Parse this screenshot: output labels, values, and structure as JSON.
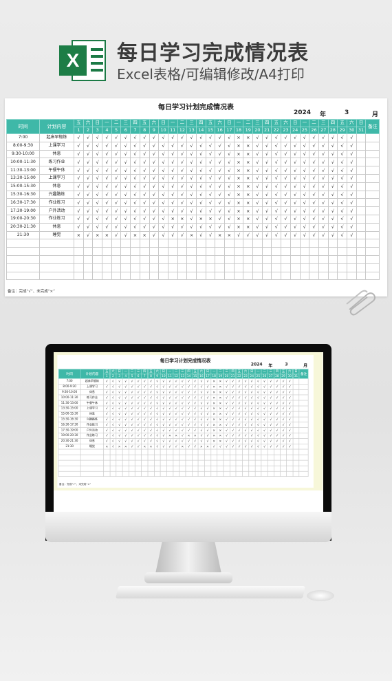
{
  "header": {
    "title": "每日学习完成情况表",
    "subtitle": "Excel表格/可编辑修改/A4打印",
    "logo_letter": "X"
  },
  "sheet": {
    "title": "每日学习计划完成情况表",
    "year": "2024",
    "year_unit": "年",
    "month": "3",
    "month_unit": "月",
    "col_time": "时间",
    "col_plan": "计划内容",
    "col_remark": "备注",
    "weekdays": [
      "五",
      "六",
      "日",
      "一",
      "二",
      "三",
      "四",
      "五",
      "六",
      "日",
      "一",
      "二",
      "三",
      "四",
      "五",
      "六",
      "日",
      "一",
      "二",
      "三",
      "四",
      "五",
      "六",
      "日",
      "一",
      "二",
      "三",
      "四",
      "五",
      "六",
      "日"
    ],
    "days": [
      "1",
      "2",
      "3",
      "4",
      "5",
      "6",
      "7",
      "8",
      "9",
      "10",
      "11",
      "12",
      "13",
      "14",
      "15",
      "16",
      "17",
      "18",
      "19",
      "20",
      "21",
      "22",
      "23",
      "24",
      "25",
      "26",
      "27",
      "28",
      "29",
      "30",
      "31"
    ],
    "rows": [
      {
        "time": "7:00",
        "plan": "起床早锻炼",
        "marks": "√√√√√√√√√√√√√√√√√××√√√√√√√√√√√"
      },
      {
        "time": "8:00-9:30",
        "plan": "上课学习",
        "marks": "√√√√√√√√√√√√√√√√√××√√√√√√√√√√√"
      },
      {
        "time": "9:30-10:00",
        "plan": "休息",
        "marks": "√√√√√√√√√√√√√√√√√××√√√√√√√√√√√"
      },
      {
        "time": "10:00-11:30",
        "plan": "练习作业",
        "marks": "√√√√√√√√√√√√√√√√√××√√√√√√√√√√√"
      },
      {
        "time": "11:30-13:00",
        "plan": "午餐午休",
        "marks": "√√√√√√√√√√√√√√√√√××√√√√√√√√√√√"
      },
      {
        "time": "13:30-15:00",
        "plan": "上课学习",
        "marks": "√√√√√√√√√√√√√√√√√××√√√√√√√√√√√"
      },
      {
        "time": "15:00-15:30",
        "plan": "休息",
        "marks": "√√√√√√√√√√√√√√√√√××√√√√√√√√√√√"
      },
      {
        "time": "15:30-16:30",
        "plan": "兴趣路练",
        "marks": "√√√√√√√√√√√√√√√√√××√√√√√√√√√√√"
      },
      {
        "time": "16:30-17:30",
        "plan": "作业练习",
        "marks": "√√√√√√√√√√√√√√√√√××√√√√√√√√√√√"
      },
      {
        "time": "17:30-19:00",
        "plan": "户外活动",
        "marks": "√√√√√√√√√√√√√√√√√××√√√√√√√√√√√"
      },
      {
        "time": "19:00-20:30",
        "plan": "作业练习",
        "marks": "√√√√√√√√√√××√××√√××√√√√√√√√√√√"
      },
      {
        "time": "20:30-21:30",
        "plan": "休息",
        "marks": "√√√√√√√√√√√√√√√√√××√√√√√√√√√√√"
      },
      {
        "time": "21:30",
        "plan": "睡觉",
        "marks": "×√××√√××√√√√×√√××√√√√√√√√√√√√√"
      }
    ],
    "empty_rows": 5,
    "note": "备注：完成“√”、未完成“×”"
  },
  "colors": {
    "accent": "#3fb8a8",
    "excel_green": "#1d7d46"
  }
}
